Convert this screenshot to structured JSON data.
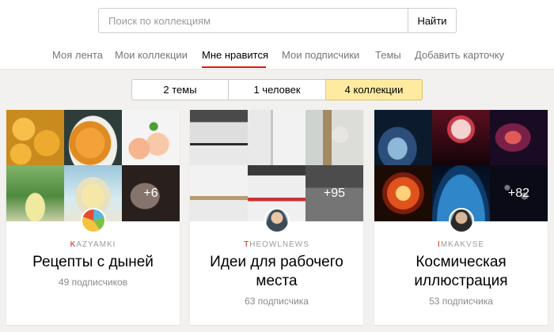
{
  "search": {
    "placeholder": "Поиск по коллекциям",
    "button_label": "Найти"
  },
  "nav": {
    "items": [
      {
        "label": "Моя лента",
        "active": false
      },
      {
        "label": "Мои коллекции",
        "active": false
      },
      {
        "label": "Мне нравится",
        "active": true
      },
      {
        "label": "Мои подписчики",
        "active": false
      },
      {
        "label": "Темы",
        "active": false
      },
      {
        "label": "Добавить карточку",
        "active": false
      }
    ],
    "accent_color": "#e61400"
  },
  "segments": {
    "items": [
      {
        "label": "2 темы",
        "active": false
      },
      {
        "label": "1 человек",
        "active": false
      },
      {
        "label": "4 коллекции",
        "active": true
      }
    ],
    "active_color": "#ffeba0"
  },
  "cards": [
    {
      "author_first": "K",
      "author_rest": "AZYAMKI",
      "title": "Рецепты с дыней",
      "subscribers": "49 подписчиков",
      "more_count": "+6",
      "avatar_icon": "vegetables-logo-icon"
    },
    {
      "author_first": "T",
      "author_rest": "HEOWLNEWS",
      "title": "Идеи для рабочего места",
      "subscribers": "63 подписчика",
      "more_count": "+95",
      "avatar_icon": "user-photo-icon"
    },
    {
      "author_first": "I",
      "author_rest": "MKAKVSE",
      "title": "Космическая иллюстрация",
      "subscribers": "53 подписчика",
      "more_count": "+82",
      "avatar_icon": "user-photo-icon"
    }
  ]
}
